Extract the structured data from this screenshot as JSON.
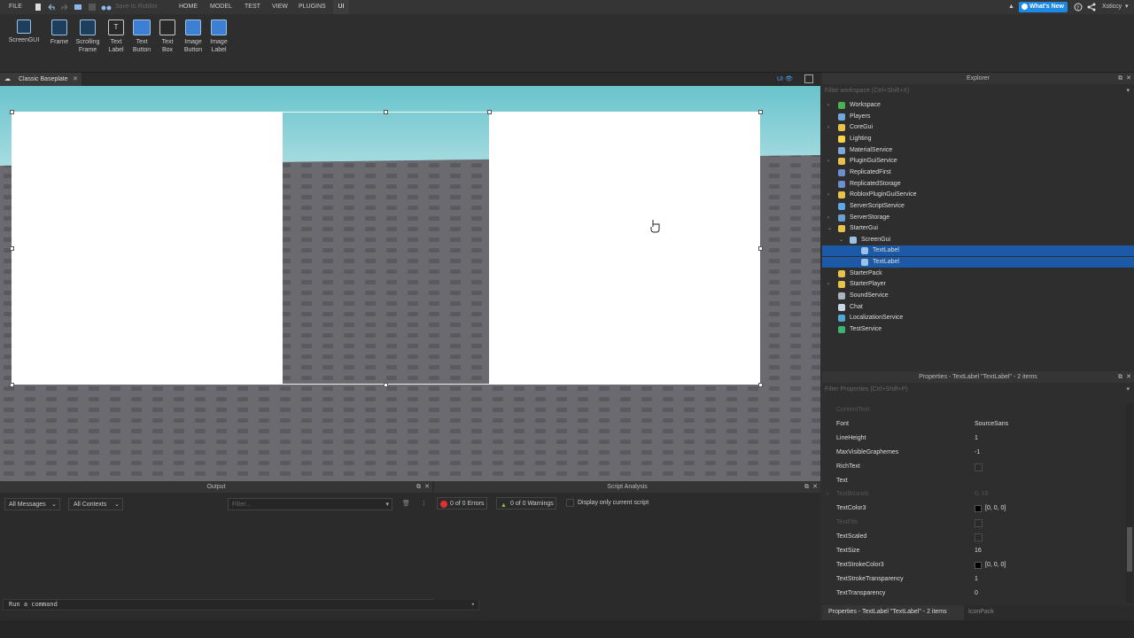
{
  "menubar": {
    "file": "FILE",
    "save_to_roblox": "Save to Roblox",
    "tabs": [
      "HOME",
      "MODEL",
      "TEST",
      "VIEW",
      "PLUGINS",
      "UI"
    ],
    "whats_new": "What's New",
    "username": "Xsticcy"
  },
  "ribbon": {
    "screengui": "ScreenGUI",
    "tools": [
      {
        "line1": "Frame",
        "line2": ""
      },
      {
        "line1": "Scrolling",
        "line2": "Frame"
      },
      {
        "line1": "Text",
        "line2": "Label"
      },
      {
        "line1": "Text",
        "line2": "Button"
      },
      {
        "line1": "Text",
        "line2": "Box"
      },
      {
        "line1": "Image",
        "line2": "Button"
      },
      {
        "line1": "Image",
        "line2": "Label"
      }
    ]
  },
  "doc_tab": {
    "title": "Classic Baseplate"
  },
  "viewport": {
    "ui_toggle": "UI"
  },
  "explorer": {
    "title": "Explorer",
    "filter_placeholder": "Filter workspace (Ctrl+Shift+X)",
    "items": [
      {
        "label": "Workspace",
        "indent": 0,
        "arrow": "right",
        "icon_color": "#4caf50",
        "selected": false
      },
      {
        "label": "Players",
        "indent": 0,
        "arrow": "",
        "icon_color": "#6fa8dc",
        "selected": false
      },
      {
        "label": "CoreGui",
        "indent": 0,
        "arrow": "right",
        "icon_color": "#e8c24a",
        "selected": false
      },
      {
        "label": "Lighting",
        "indent": 0,
        "arrow": "",
        "icon_color": "#f5d547",
        "selected": false
      },
      {
        "label": "MaterialService",
        "indent": 0,
        "arrow": "",
        "icon_color": "#7fa7d9",
        "selected": false
      },
      {
        "label": "PluginGuiService",
        "indent": 0,
        "arrow": "right",
        "icon_color": "#e8c24a",
        "selected": false
      },
      {
        "label": "ReplicatedFirst",
        "indent": 0,
        "arrow": "",
        "icon_color": "#6b8fd1",
        "selected": false
      },
      {
        "label": "ReplicatedStorage",
        "indent": 0,
        "arrow": "",
        "icon_color": "#6b8fd1",
        "selected": false
      },
      {
        "label": "RobloxPluginGuiService",
        "indent": 0,
        "arrow": "right",
        "icon_color": "#e8c24a",
        "selected": false
      },
      {
        "label": "ServerScriptService",
        "indent": 0,
        "arrow": "",
        "icon_color": "#5fa8e8",
        "selected": false
      },
      {
        "label": "ServerStorage",
        "indent": 0,
        "arrow": "right",
        "icon_color": "#6b9fd1",
        "selected": false
      },
      {
        "label": "StarterGui",
        "indent": 0,
        "arrow": "down",
        "icon_color": "#e8c24a",
        "selected": false
      },
      {
        "label": "ScreenGui",
        "indent": 1,
        "arrow": "down",
        "icon_color": "#9bc3e8",
        "selected": false
      },
      {
        "label": "TextLabel",
        "indent": 2,
        "arrow": "",
        "icon_color": "#9bc3e8",
        "selected": true
      },
      {
        "label": "TextLabel",
        "indent": 2,
        "arrow": "",
        "icon_color": "#9bc3e8",
        "selected": true
      },
      {
        "label": "StarterPack",
        "indent": 0,
        "arrow": "",
        "icon_color": "#e8c24a",
        "selected": false
      },
      {
        "label": "StarterPlayer",
        "indent": 0,
        "arrow": "right",
        "icon_color": "#e8c24a",
        "selected": false
      },
      {
        "label": "SoundService",
        "indent": 0,
        "arrow": "",
        "icon_color": "#aab4c0",
        "selected": false
      },
      {
        "label": "Chat",
        "indent": 0,
        "arrow": "",
        "icon_color": "#c8d8e8",
        "selected": false
      },
      {
        "label": "LocalizationService",
        "indent": 0,
        "arrow": "",
        "icon_color": "#4fa8d8",
        "selected": false
      },
      {
        "label": "TestService",
        "indent": 0,
        "arrow": "",
        "icon_color": "#3cb371",
        "selected": false
      }
    ]
  },
  "properties": {
    "title": "Properties - TextLabel \"TextLabel\" - 2 items",
    "filter_placeholder": "Filter Properties (Ctrl+Shift+P)",
    "rows": [
      {
        "name": "ContentText",
        "value": "",
        "dim": true,
        "kind": "text"
      },
      {
        "name": "Font",
        "value": "SourceSans",
        "dim": false,
        "kind": "text"
      },
      {
        "name": "LineHeight",
        "value": "1",
        "dim": false,
        "kind": "text"
      },
      {
        "name": "MaxVisibleGraphemes",
        "value": "-1",
        "dim": false,
        "kind": "text"
      },
      {
        "name": "RichText",
        "value": "",
        "dim": false,
        "kind": "check"
      },
      {
        "name": "Text",
        "value": "",
        "dim": false,
        "kind": "text"
      },
      {
        "name": "TextBounds",
        "value": "0, 16",
        "dim": true,
        "kind": "text",
        "arrow": true
      },
      {
        "name": "TextColor3",
        "value": "[0, 0, 0]",
        "dim": false,
        "kind": "color"
      },
      {
        "name": "TextFits",
        "value": "",
        "dim": true,
        "kind": "check"
      },
      {
        "name": "TextScaled",
        "value": "",
        "dim": false,
        "kind": "check"
      },
      {
        "name": "TextSize",
        "value": "16",
        "dim": false,
        "kind": "text"
      },
      {
        "name": "TextStrokeColor3",
        "value": "[0, 0, 0]",
        "dim": false,
        "kind": "color"
      },
      {
        "name": "TextStrokeTransparency",
        "value": "1",
        "dim": false,
        "kind": "text"
      },
      {
        "name": "TextTransparency",
        "value": "0",
        "dim": false,
        "kind": "text"
      }
    ]
  },
  "prop_tabs": {
    "active": "Properties - TextLabel \"TextLabel\" - 2 items",
    "other": "IconPack"
  },
  "output": {
    "title": "Output",
    "messages_filter": "All Messages",
    "contexts_filter": "All Contexts",
    "filter_placeholder": "Filter...",
    "command_placeholder": "Run a command"
  },
  "script_analysis": {
    "title": "Script Analysis",
    "errors": "0 of 0 Errors",
    "warnings": "0 of 0 Warnings",
    "display_current": "Display only current script"
  }
}
